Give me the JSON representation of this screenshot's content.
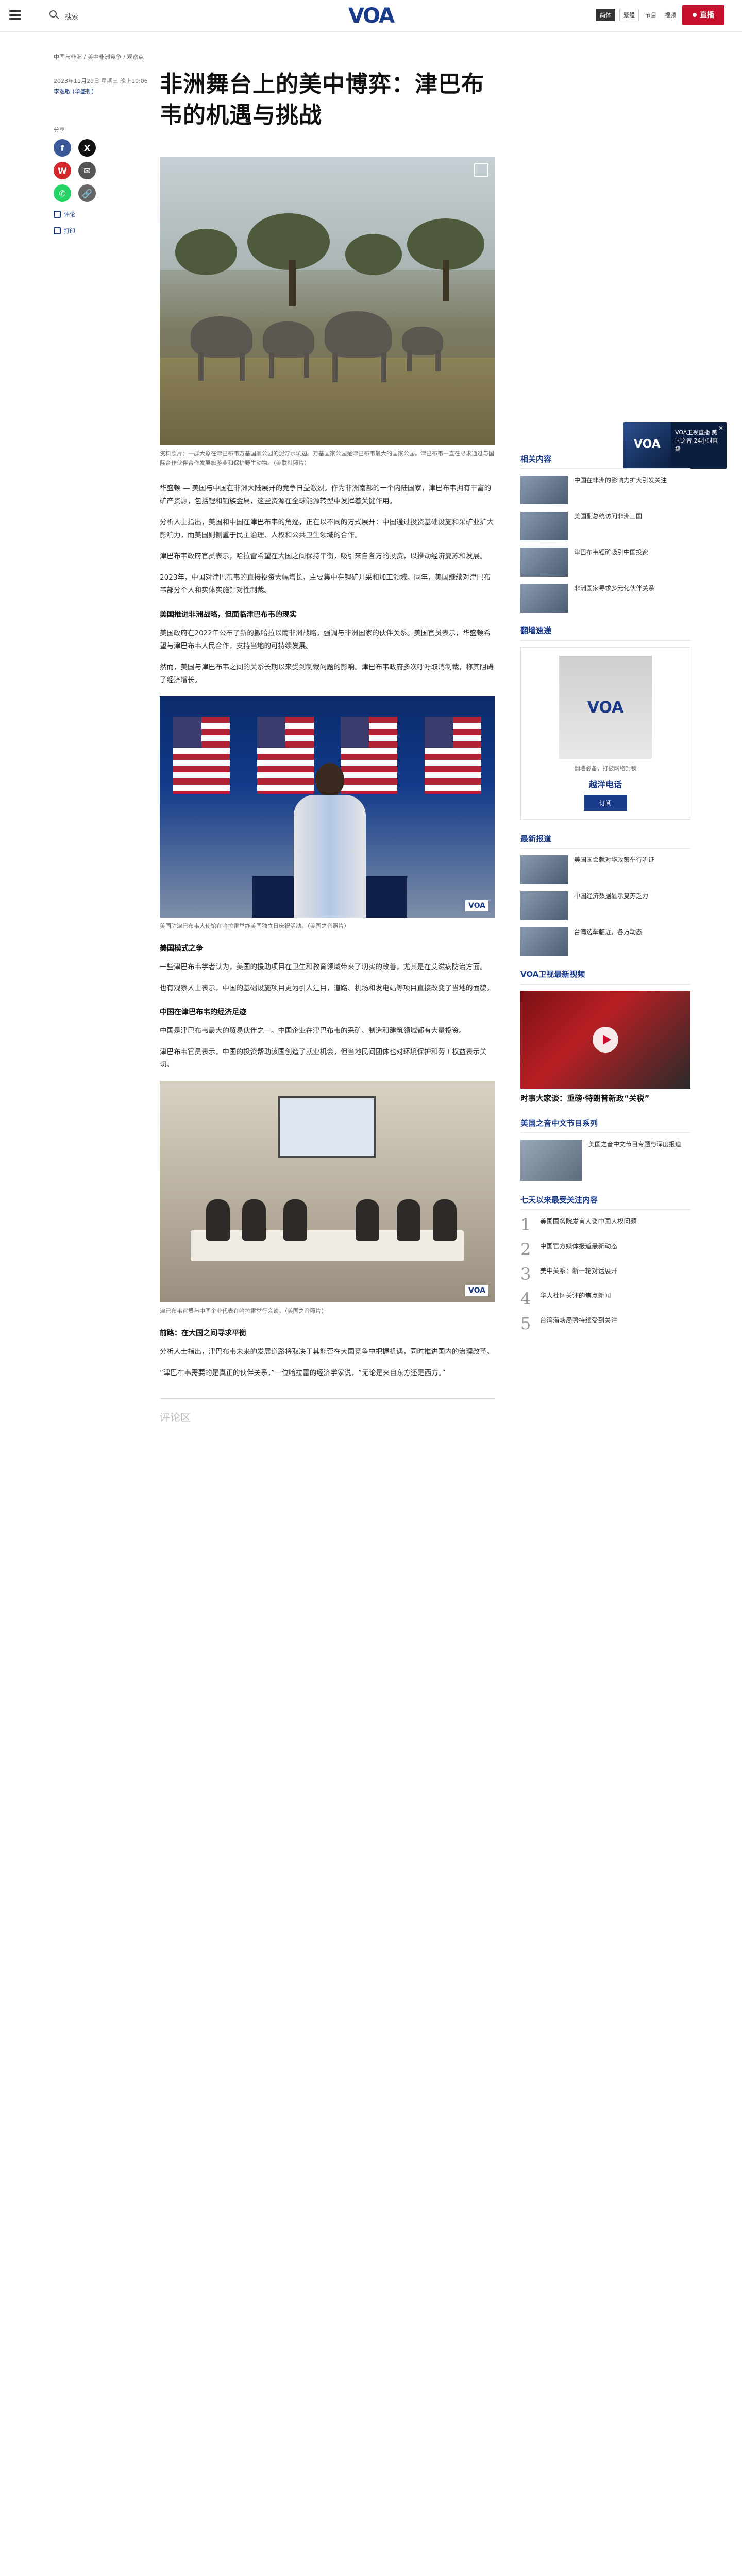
{
  "header": {
    "search_label": "搜索",
    "logo_text": "VOA",
    "langs": [
      "简体",
      "繁體"
    ],
    "active_lang": "简体",
    "extra_links": [
      "节目",
      "视频"
    ],
    "live_label": "直播"
  },
  "article": {
    "breadcrumb": "中国与非洲 / 美中非洲竞争 / 观察点",
    "date": "2023年11月29日 星期三 晚上10:06",
    "author": "李逸敏 (华盛顿)",
    "title": "非洲舞台上的美中博弈：津巴布韦的机遇与挑战",
    "share_label": "分享",
    "side_actions": [
      "评论",
      "打印"
    ],
    "hero_caption": "资料照片：一群大象在津巴布韦万基国家公园的泥泞水坑边。万基国家公园是津巴布韦最大的国家公园。津巴布韦一直在寻求通过与国际合作伙伴合作发展旅游业和保护野生动物。（美联社照片）",
    "paragraphs": [
      "华盛顿 — 美国与中国在非洲大陆展开的竞争日益激烈。作为非洲南部的一个内陆国家，津巴布韦拥有丰富的矿产资源，包括锂和铂族金属，这些资源在全球能源转型中发挥着关键作用。",
      "分析人士指出，美国和中国在津巴布韦的角逐，正在以不同的方式展开：中国通过投资基础设施和采矿业扩大影响力，而美国则侧重于民主治理、人权和公共卫生领域的合作。",
      "津巴布韦政府官员表示，哈拉雷希望在大国之间保持平衡，吸引来自各方的投资，以推动经济复苏和发展。",
      "2023年，中国对津巴布韦的直接投资大幅增长，主要集中在锂矿开采和加工领域。同年，美国继续对津巴布韦部分个人和实体实施针对性制裁。"
    ],
    "subhead_1": "美国推进非洲战略，但面临津巴布韦的现实",
    "paragraphs_b": [
      "美国政府在2022年公布了新的撒哈拉以南非洲战略，强调与非洲国家的伙伴关系。美国官员表示，华盛顿希望与津巴布韦人民合作，支持当地的可持续发展。",
      "然而，美国与津巴布韦之间的关系长期以来受到制裁问题的影响。津巴布韦政府多次呼吁取消制裁，称其阻碍了经济增长。"
    ],
    "photo_caption_1": "美国驻津巴布韦大使馆在哈拉雷举办美国独立日庆祝活动。（美国之音照片）",
    "subhead_2": "美国模式之争",
    "paragraphs_c": [
      "一些津巴布韦学者认为，美国的援助项目在卫生和教育领域带来了切实的改善，尤其是在艾滋病防治方面。",
      "也有观察人士表示，中国的基础设施项目更为引人注目，道路、机场和发电站等项目直接改变了当地的面貌。"
    ],
    "subhead_3": "中国在津巴布韦的经济足迹",
    "paragraphs_d": [
      "中国是津巴布韦最大的贸易伙伴之一。中国企业在津巴布韦的采矿、制造和建筑领域都有大量投资。",
      "津巴布韦官员表示，中国的投资帮助该国创造了就业机会，但当地民间团体也对环境保护和劳工权益表示关切。"
    ],
    "photo_caption_2": "津巴布韦官员与中国企业代表在哈拉雷举行会谈。（美国之音照片）",
    "subhead_4": "前路：在大国之间寻求平衡",
    "paragraphs_e": [
      "分析人士指出，津巴布韦未来的发展道路将取决于其能否在大国竞争中把握机遇，同时推进国内的治理改革。",
      "“津巴布韦需要的是真正的伙伴关系，”一位哈拉雷的经济学家说，“无论是来自东方还是西方。”"
    ],
    "comments_label": "评论区"
  },
  "rail": {
    "related_heading": "相关内容",
    "related": [
      "中国在非洲的影响力扩大引发关注",
      "美国副总统访问非洲三国",
      "津巴布韦锂矿吸引中国投资",
      "非洲国家寻求多元化伙伴关系"
    ],
    "promo_heading": "翻墙速递",
    "promo_text": "翻墙必备，打破网络封锁",
    "promo_title": "越洋电话",
    "promo_button": "订阅",
    "news_heading": "最新报道",
    "news": [
      "美国国会就对华政策举行听证",
      "中国经济数据显示复苏乏力",
      "台湾选举临近，各方动态"
    ],
    "video_heading": "VOA卫视最新视频",
    "video_title": "时事大家谈：重磅·特朗普新政“关税”",
    "chinese_heading": "美国之音中文节目系列",
    "chinese_text": "美国之音中文节目专题与深度报道",
    "rank_heading": "七天以来最受关注内容",
    "rank": [
      "美国国务院发言人谈中国人权问题",
      "中国官方媒体报道最新动态",
      "美中关系：新一轮对话展开",
      "华人社区关注的焦点新闻",
      "台湾海峡局势持续受到关注"
    ]
  },
  "float_live": {
    "text": "VOA卫视直播 美国之音 24小时直播",
    "close": "✕"
  },
  "colors": {
    "brand": "#1a3b89",
    "live": "#c8102e"
  }
}
